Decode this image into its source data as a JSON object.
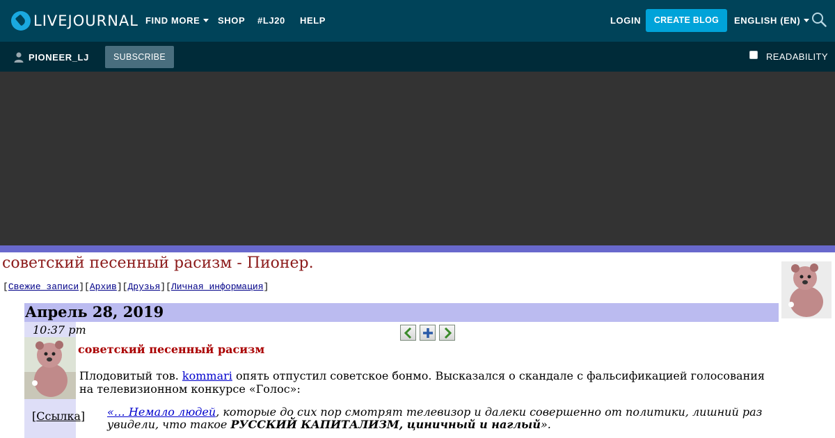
{
  "header": {
    "logo_text": "LIVEJOURNAL",
    "nav": {
      "find_more": "FIND MORE",
      "shop": "SHOP",
      "lj20": "#LJ20",
      "help": "HELP"
    },
    "login": "LOGIN",
    "create_blog": "CREATE BLOG",
    "language": "ENGLISH (EN)",
    "search_icon": "search-icon"
  },
  "subheader": {
    "username": "PIONEER_LJ",
    "subscribe": "SUBSCRIBE",
    "readability": "READABILITY",
    "readability_checked": false
  },
  "journal": {
    "title": "советский песенный расизм - Пионер.",
    "links": [
      "Свежие записи",
      "Архив",
      "Друзья",
      "Личная информация"
    ]
  },
  "entry": {
    "date": "Апрель 28, 2019",
    "time": "10:37 pm",
    "permalink": "Ссылка",
    "title": "советский песенный расизм",
    "body_before": "Плодовитый тов. ",
    "body_link": "kommari",
    "body_after": " опять отпустил советское бонмо. Высказался о скандале с фальсификацией голосования на телевизионном конкурсе «Голос»:",
    "quote_link": "«… Немало людей",
    "quote_text": ", которые до сих пор смотрят телевизор и далеки совершенно от политики, лишний раз увидели, что такое ",
    "quote_bold": "РУССКИЙ КАПИТАЛИЗМ, циничный и наглый",
    "quote_end": "»."
  },
  "colors": {
    "topbar": "#004359",
    "subbar": "#002b39",
    "accent": "#00a3d9",
    "ad_area": "#333333",
    "stripe": "#6868cc",
    "title": "#8b1a1a",
    "date_band": "#bbbbf0"
  }
}
